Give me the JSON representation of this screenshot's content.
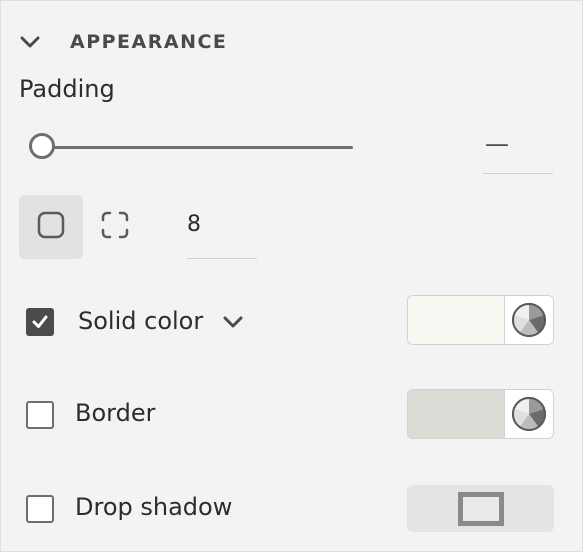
{
  "section": {
    "title": "APPEARANCE",
    "chevron_icon": "chevron-down-icon"
  },
  "padding": {
    "label": "Padding",
    "slider_value": "—",
    "slider_level": 0,
    "input_value": "8",
    "uniform_icon": "square-icon",
    "individual_icon": "dashed-square-icon"
  },
  "solid_color": {
    "label": "Solid color",
    "checked": true,
    "color": "#f9f8f2",
    "picker_icon": "color-wheel-icon"
  },
  "border": {
    "label": "Border",
    "checked": false,
    "color": "#dcdbd6",
    "picker_icon": "color-wheel-icon"
  },
  "drop_shadow": {
    "label": "Drop shadow",
    "checked": false,
    "preview_icon": "shadow-preview-icon"
  }
}
